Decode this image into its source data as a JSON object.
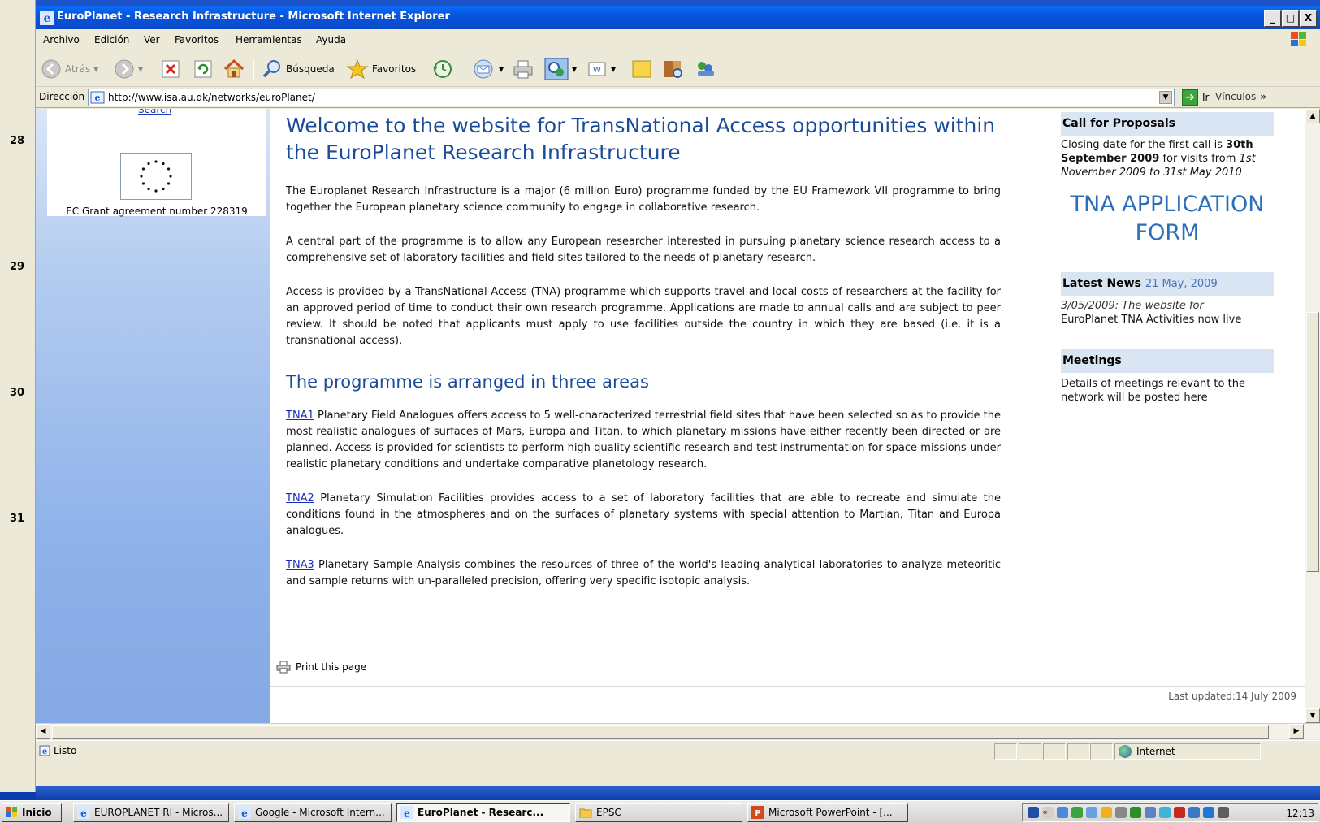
{
  "window": {
    "title": "EuroPlanet - Research Infrastructure - Microsoft Internet Explorer",
    "buttons": {
      "minimize": "_",
      "maximize": "□",
      "close": "X"
    }
  },
  "menu": [
    "Archivo",
    "Edición",
    "Ver",
    "Favoritos",
    "Herramientas",
    "Ayuda"
  ],
  "toolbar": {
    "back_label": "Atrás",
    "search_label": "Búsqueda",
    "favorites_label": "Favoritos"
  },
  "address": {
    "label": "Dirección",
    "url": "http://www.isa.au.dk/networks/euroPlanet/",
    "go_label": "Ir",
    "links_label": "Vínculos",
    "links_chevron": "»"
  },
  "ppt_slide_numbers": [
    "28",
    "29",
    "30",
    "31"
  ],
  "sidebar": {
    "search_link": "Search",
    "ec_caption": "EC Grant agreement number 228319"
  },
  "main": {
    "title": "Welcome to the website for TransNational Access opportunities within the EuroPlanet Research Infrastructure",
    "paragraphs": [
      "The Europlanet Research Infrastructure is a major (6 million Euro) programme funded by the EU Framework VII programme to bring together the European planetary science community to engage in collaborative research.",
      "A central part of the programme is to allow any European researcher interested in pursuing planetary science research access to a comprehensive set of laboratory facilities and field sites tailored to the needs of planetary research.",
      "Access is provided by a TransNational Access (TNA) programme which supports travel and local costs of researchers at the facility for an approved period of time to conduct their own research programme. Applications are made to annual calls and are subject to peer review. It should be noted that applicants must apply to use facilities outside the country in which they are based (i.e. it is a transnational access)."
    ],
    "subheading": "The programme is arranged in three areas",
    "tna": [
      {
        "link": "TNA1",
        "text": " Planetary Field Analogues offers access to 5 well-characterized terrestrial field sites that have been selected so as to provide the most realistic analogues of surfaces of Mars, Europa and Titan, to which planetary missions have either recently been directed or are planned. Access is provided for scientists to perform high quality scientific research and test instrumentation for space missions under realistic planetary conditions and undertake comparative planetology research."
      },
      {
        "link": "TNA2",
        "text": " Planetary Simulation Facilities provides access to a set of laboratory facilities that are able to recreate and simulate the conditions found in the atmospheres and on the surfaces of planetary systems with special attention to Martian, Titan and Europa analogues."
      },
      {
        "link": "TNA3",
        "text": " Planetary Sample Analysis combines the resources of three of the world's leading analytical laboratories to analyze meteoritic and sample returns with un-paralleled precision, offering very specific isotopic analysis."
      }
    ],
    "print_label": "Print this page",
    "last_updated": "Last updated:14 July 2009"
  },
  "right": {
    "call_heading": "Call for Proposals",
    "call_text_1": "Closing date for the first call is ",
    "call_date": "30th September 2009",
    "call_text_2": " for visits from ",
    "call_period": "1st November 2009 to 31st May 2010",
    "tna_form": "TNA APPLICATION FORM",
    "news_heading": "Latest News",
    "news_date": "21 May, 2009",
    "news_item_date": "3/05/2009: The website for",
    "news_item_text": "EuroPlanet TNA Activities now live",
    "meetings_heading": "Meetings",
    "meetings_text": "Details of meetings relevant to the network will be posted here"
  },
  "status": {
    "text": "Listo",
    "zone": "Internet"
  },
  "taskbar": {
    "start": "Inicio",
    "tasks": [
      "EUROPLANET RI - Micros...",
      "Google - Microsoft Intern...",
      "EuroPlanet - Researc...",
      "EPSC",
      "Microsoft PowerPoint - [..."
    ],
    "clock": "12:13"
  },
  "colors": {
    "title_blue": "#1b4c9a",
    "link_blue": "#1a2cb8",
    "tna_form_blue": "#2b6fb8",
    "right_head_bg": "#dae5f3"
  }
}
